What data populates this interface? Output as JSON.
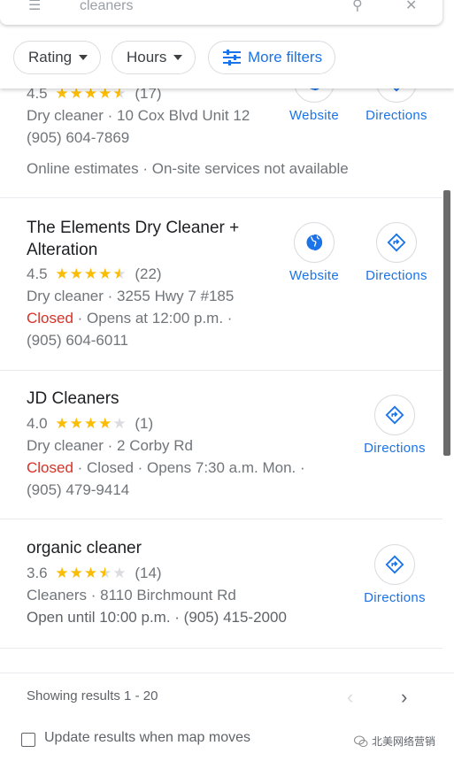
{
  "search": {
    "query": "cleaners"
  },
  "filters": {
    "rating": "Rating",
    "hours": "Hours",
    "more": "More filters"
  },
  "results": [
    {
      "rating_value": "4.5",
      "rating_count": "(17)",
      "stars": 4.5,
      "type_address": "Dry cleaner · 10 Cox Blvd Unit 12",
      "phone": "(905) 604-7869",
      "extra": "Online estimates · On-site services not available",
      "website_label": "Website",
      "directions_label": "Directions"
    },
    {
      "name": "The Elements Dry Cleaner + Alteration",
      "rating_value": "4.5",
      "rating_count": "(22)",
      "stars": 4.5,
      "type_address": "Dry cleaner · 3255 Hwy 7 #185",
      "status": "Closed",
      "hours_text": " · Opens at 12:00 p.m. ·",
      "phone": "(905) 604-6011",
      "website_label": "Website",
      "directions_label": "Directions"
    },
    {
      "name": "JD Cleaners",
      "rating_value": "4.0",
      "rating_count": "(1)",
      "stars": 4.0,
      "type_address": "Dry cleaner · 2 Corby Rd",
      "status": "Closed",
      "hours_text": " · Closed · Opens 7:30 a.m. Mon. ·",
      "phone": "(905) 479-9414",
      "directions_label": "Directions"
    },
    {
      "name": "organic cleaner",
      "rating_value": "3.6",
      "rating_count": "(14)",
      "stars": 3.5,
      "type_address": "Cleaners · 8110 Birchmount Rd",
      "hours_line": "Open until 10:00 p.m. · (905) 415-2000",
      "directions_label": "Directions"
    }
  ],
  "footer": {
    "showing": "Showing results 1 - 20",
    "update_label": "Update results when map moves",
    "watermark": "北美网络营销"
  },
  "colors": {
    "accent": "#1a73e8",
    "star": "#fbbc04",
    "closed": "#d93025"
  }
}
